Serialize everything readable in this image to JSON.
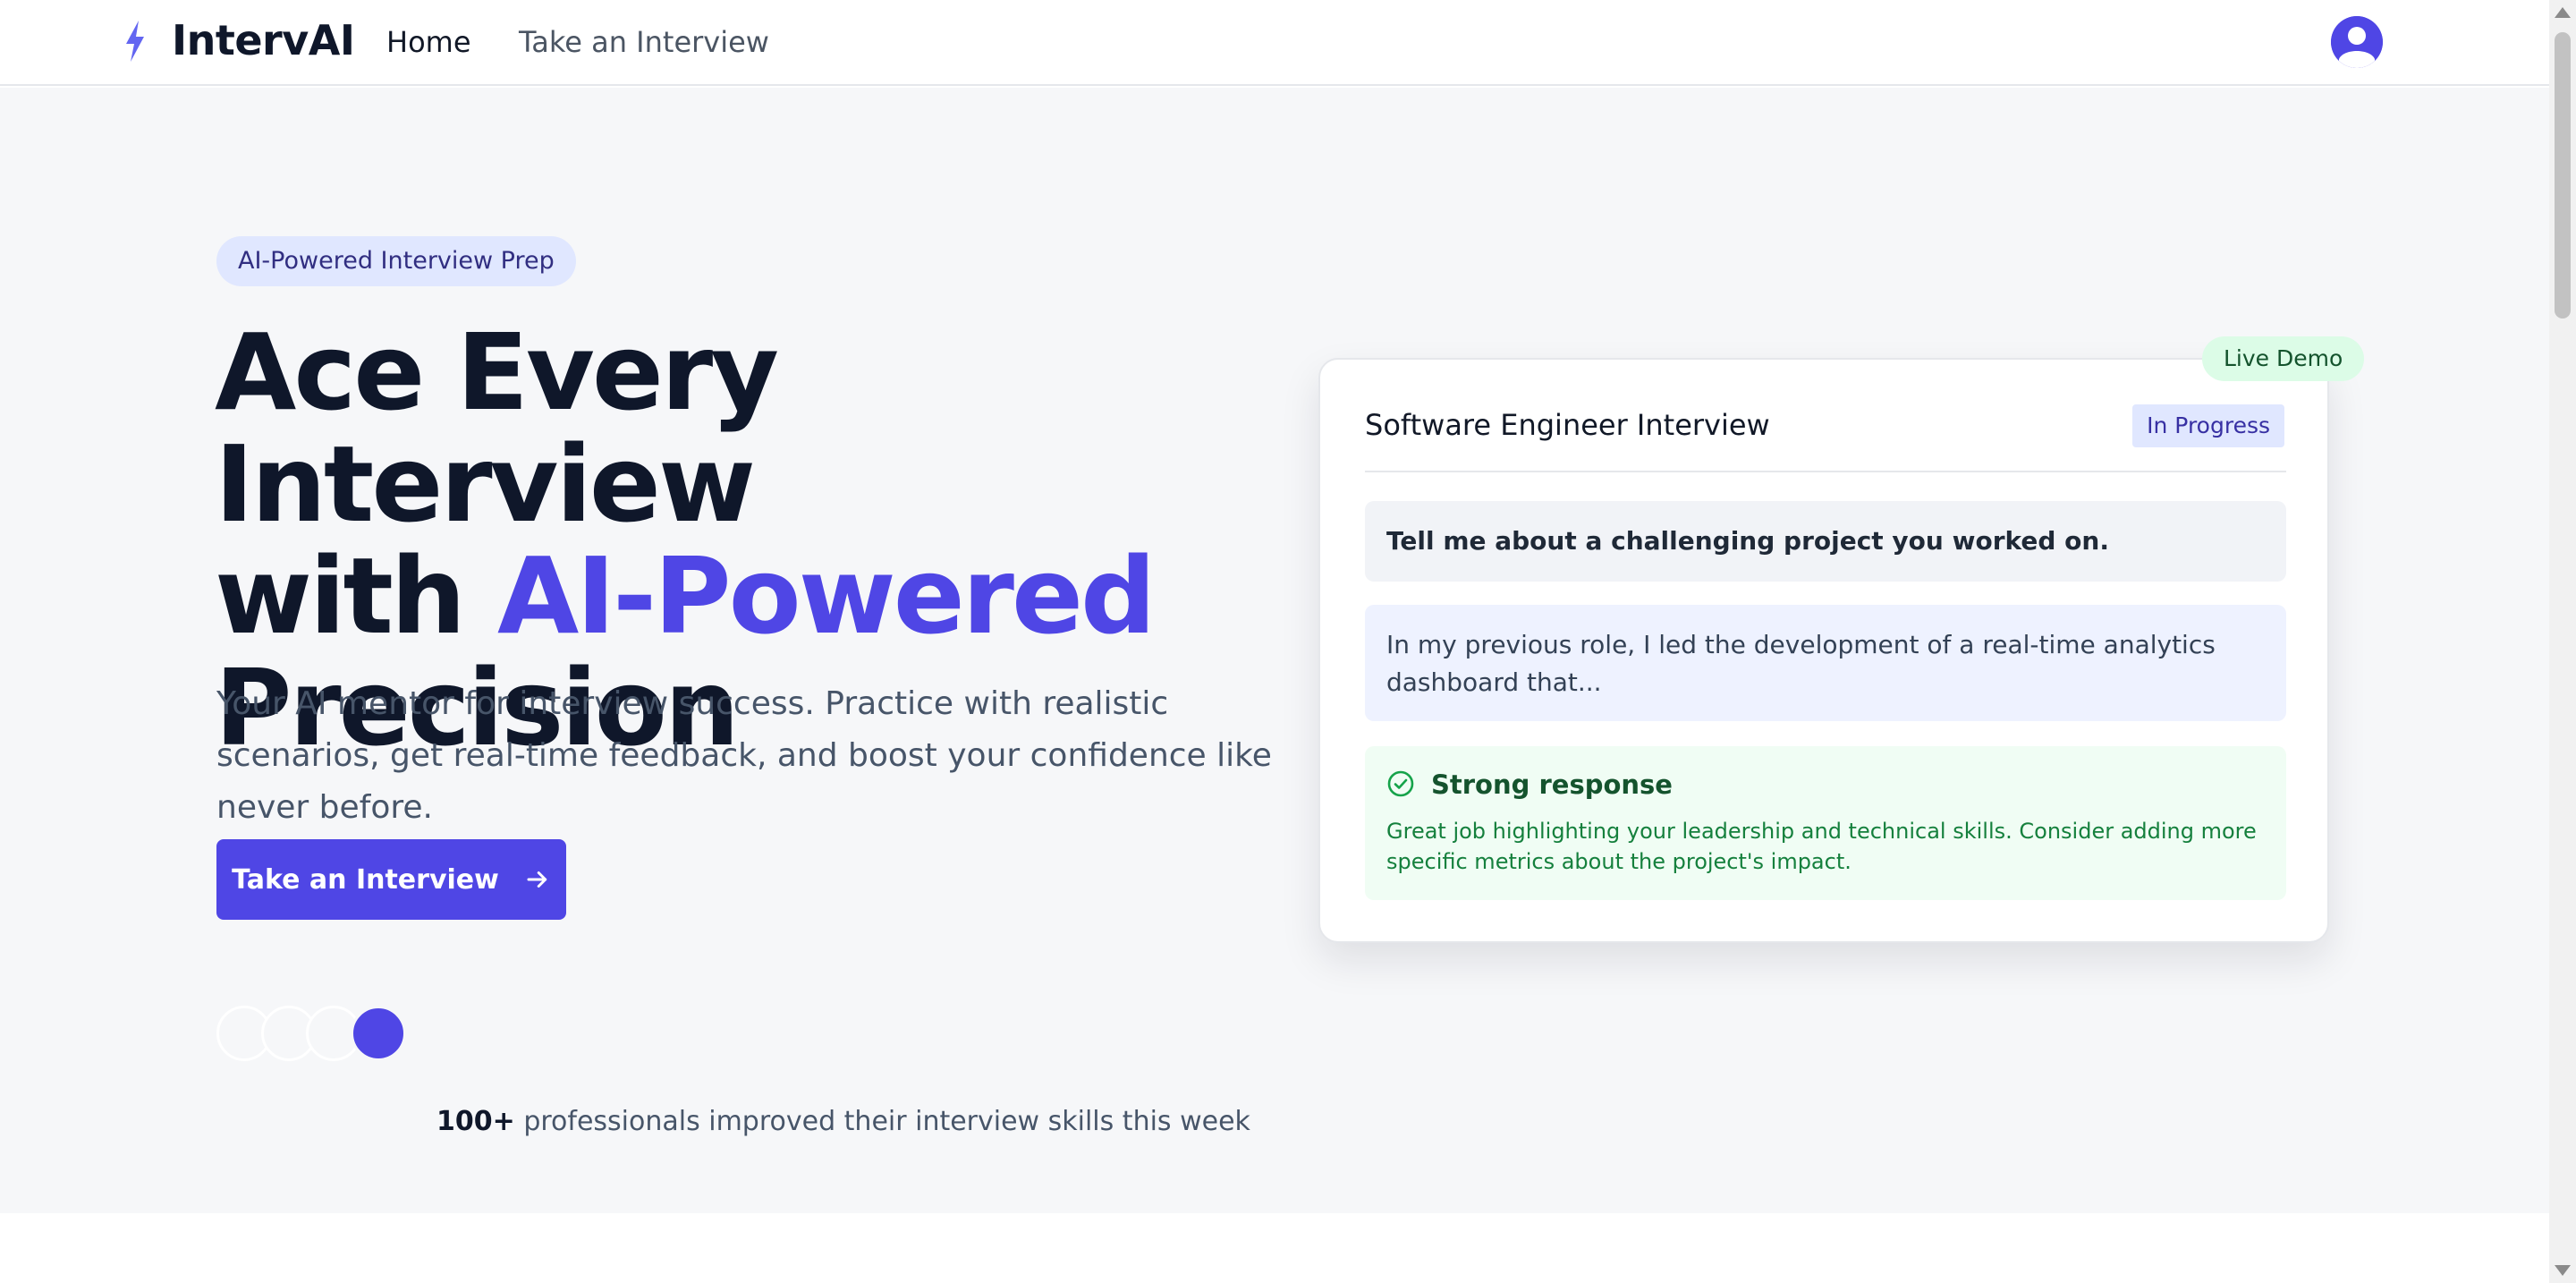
{
  "nav": {
    "brand": "IntervAI",
    "links": [
      {
        "label": "Home",
        "active": true
      },
      {
        "label": "Take an Interview",
        "active": false
      }
    ],
    "icons": {
      "logo": "lightning-bolt-icon",
      "avatar": "user-avatar-icon"
    }
  },
  "hero": {
    "badge": "AI-Powered Interview Prep",
    "headline_line1": "Ace Every Interview",
    "headline_with": "with ",
    "headline_accent": "AI-Powered",
    "headline_line3": "Precision",
    "subtext": "Your AI mentor for interview success. Practice with realistic scenarios, get real-time feedback, and boost your confidence like never before.",
    "cta_label": "Take an Interview",
    "cta_icon": "arrow-right-icon",
    "social_count": "100+",
    "social_text": "professionals improved their interview skills this week"
  },
  "demo": {
    "live_badge": "Live Demo",
    "title": "Software Engineer Interview",
    "status": "In Progress",
    "question": "Tell me about a challenging project you worked on.",
    "answer": "In my previous role, I led the development of a real-time analytics dashboard that...",
    "feedback_title": "Strong response",
    "feedback_icon": "check-circle-icon",
    "feedback_body": "Great job highlighting your leadership and technical skills. Consider adding more specific metrics about the project's impact."
  },
  "colors": {
    "accent": "#4f46e5",
    "hero_bg": "#f6f7f9",
    "success_bg": "#f0fdf4",
    "success_text": "#15803d"
  }
}
